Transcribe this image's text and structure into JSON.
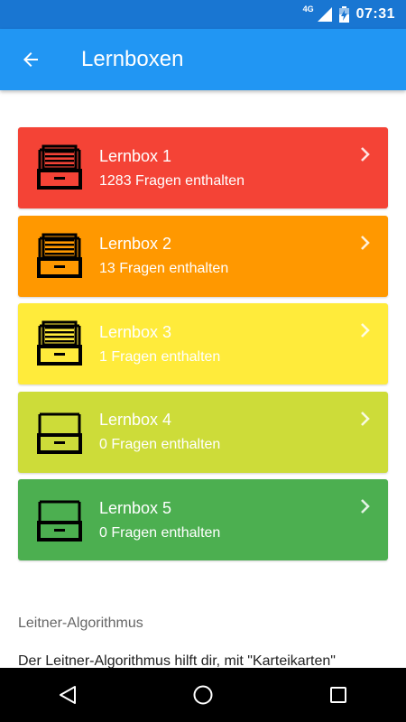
{
  "status_bar": {
    "network": "4G",
    "time": "07:31"
  },
  "app_bar": {
    "title": "Lernboxen",
    "back_icon": "arrow-left-icon"
  },
  "boxes": [
    {
      "name": "Lernbox 1",
      "count": "1283 Fragen enthalten",
      "color": "#F44336",
      "level": "full"
    },
    {
      "name": "Lernbox 2",
      "count": "13 Fragen enthalten",
      "color": "#FF9800",
      "level": "full"
    },
    {
      "name": "Lernbox 3",
      "count": "1 Fragen enthalten",
      "color": "#FFEB3B",
      "level": "full"
    },
    {
      "name": "Lernbox 4",
      "count": "0 Fragen enthalten",
      "color": "#CDDC39",
      "level": "empty"
    },
    {
      "name": "Lernbox 5",
      "count": "0 Fragen enthalten",
      "color": "#4CAF50",
      "level": "empty"
    }
  ],
  "info": {
    "heading": "Leitner-Algorithmus",
    "text": "Der Leitner-Algorithmus hilft dir, mit \"Karteikarten\""
  },
  "nav_bar": {
    "back_icon": "triangle-back-icon",
    "home_icon": "circle-home-icon",
    "recents_icon": "square-recents-icon"
  }
}
